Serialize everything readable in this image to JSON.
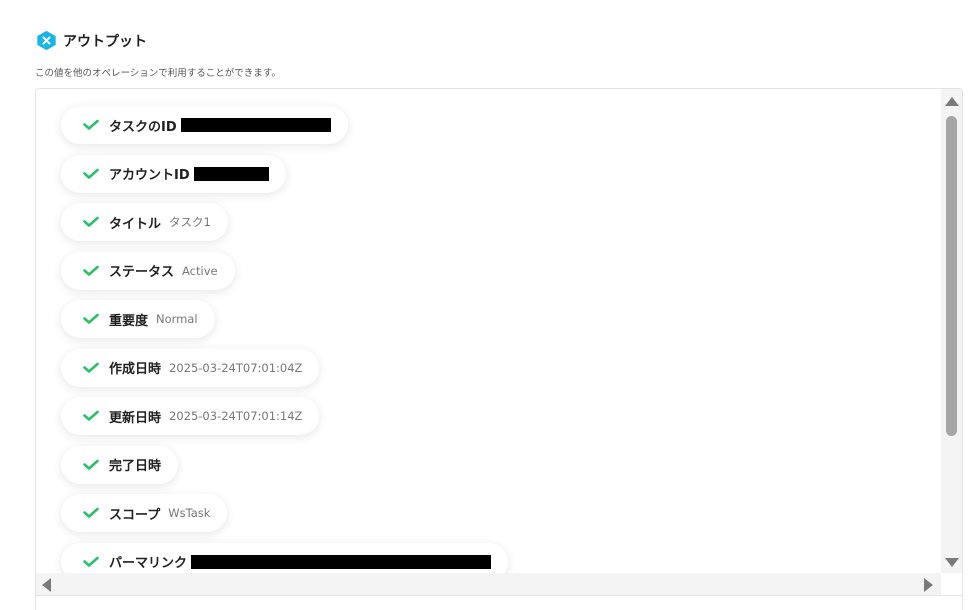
{
  "header": {
    "icon": "x-hexagon-icon",
    "icon_color": "#1ab5e6",
    "title": "アウトプット",
    "subtitle": "この値を他のオペレーションで利用することができます。"
  },
  "check_color": "#2bbf6a",
  "fields": [
    {
      "label": "タスクのID",
      "value": "",
      "redacted": true
    },
    {
      "label": "アカウントID",
      "value": "",
      "redacted": true
    },
    {
      "label": "タイトル",
      "value": "タスク1",
      "redacted": false
    },
    {
      "label": "ステータス",
      "value": "Active",
      "redacted": false
    },
    {
      "label": "重要度",
      "value": "Normal",
      "redacted": false
    },
    {
      "label": "作成日時",
      "value": "2025-03-24T07:01:04Z",
      "redacted": false
    },
    {
      "label": "更新日時",
      "value": "2025-03-24T07:01:14Z",
      "redacted": false
    },
    {
      "label": "完了日時",
      "value": "",
      "redacted": false
    },
    {
      "label": "スコープ",
      "value": "WsTask",
      "redacted": false
    },
    {
      "label": "パーマリンク",
      "value": "",
      "redacted": true
    }
  ]
}
